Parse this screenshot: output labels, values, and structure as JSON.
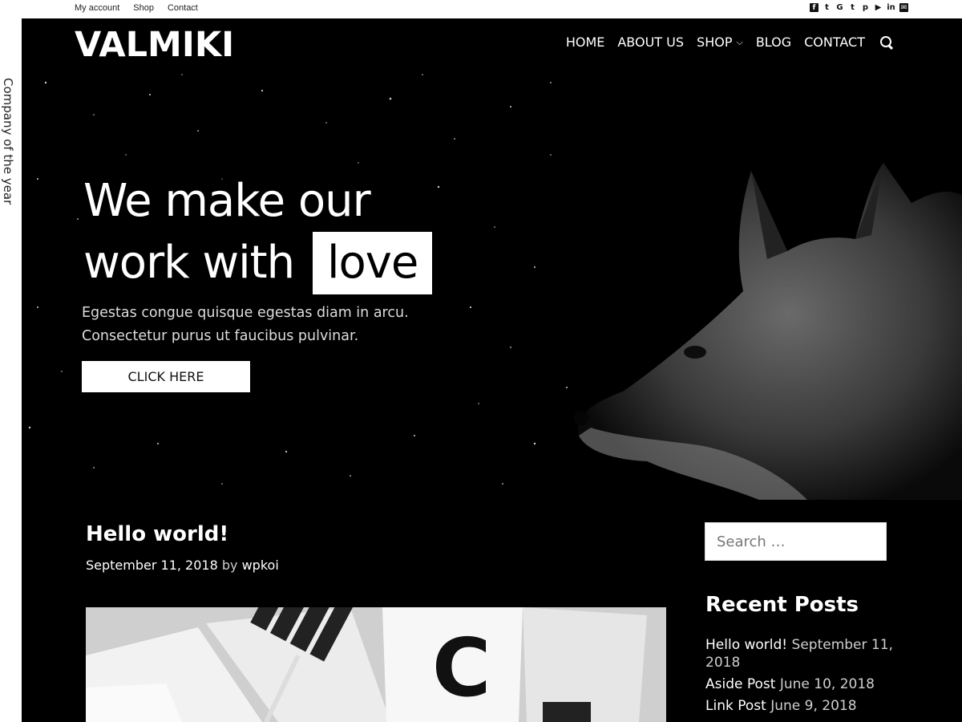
{
  "topbar": {
    "links": [
      "My account",
      "Shop",
      "Contact"
    ],
    "social_icons": [
      "facebook-icon",
      "twitter-icon",
      "google-icon",
      "tumblr-icon",
      "pinterest-icon",
      "youtube-icon",
      "linkedin-icon",
      "email-icon"
    ],
    "social_glyphs": [
      "f",
      "t",
      "G",
      "t",
      "p",
      "▶",
      "in",
      "✉"
    ]
  },
  "side_label": "Company of the year",
  "header": {
    "logo": "VALMIKI",
    "nav": {
      "home": "HOME",
      "about": "ABOUT US",
      "shop": "SHOP",
      "blog": "BLOG",
      "contact": "CONTACT"
    }
  },
  "hero": {
    "title_line1": "We make our",
    "title_line2": "work with",
    "title_highlight": "love",
    "subtitle_line1": "Egestas congue quisque egestas diam in arcu.",
    "subtitle_line2": "Consectetur purus ut faucibus pulvinar.",
    "button_label": "CLICK HERE"
  },
  "post": {
    "title": "Hello world!",
    "date": "September 11, 2018",
    "by": "by",
    "author": "wpkoi"
  },
  "sidebar": {
    "search_placeholder": "Search …",
    "recent_title": "Recent Posts",
    "recent_posts": [
      {
        "title": "Hello world!",
        "date": "September 11, 2018"
      },
      {
        "title": "Aside Post",
        "date": "June 10, 2018"
      },
      {
        "title": "Link Post",
        "date": "June 9, 2018"
      }
    ]
  },
  "colors": {
    "background": "#000000",
    "text": "#ffffff",
    "accent": "#ffffff"
  }
}
